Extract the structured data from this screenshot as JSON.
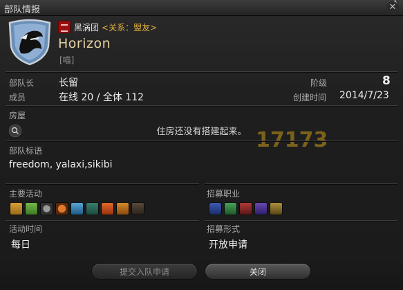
{
  "window": {
    "title": "部队情报",
    "close_symbol": "✕"
  },
  "company": {
    "relation_name": "黑涡团",
    "relation_text": "<关系：盟友>",
    "name": "Horizon",
    "tag": "[喵]"
  },
  "info": {
    "leader_label": "部队长",
    "leader_value": "长留",
    "rank_label": "阶级",
    "rank_value": "8",
    "members_label": "成员",
    "members_value": "在线 20 / 全体 112",
    "created_label": "创建时间",
    "created_value": "2014/7/23"
  },
  "housing": {
    "label": "房屋",
    "message": "住房还没有搭建起来。"
  },
  "slogan": {
    "label": "部队标语",
    "text": "freedom, yalaxi,sikibi"
  },
  "activities": {
    "label": "主要活动",
    "icons": [
      "role-playing-icon",
      "leveling-icon",
      "casual-icon",
      "hardcore-icon",
      "dungeons-icon",
      "guildhests-icon",
      "trials-icon",
      "raids-icon",
      "pvp-icon"
    ]
  },
  "recruit_roles": {
    "label": "招募职业",
    "icons": [
      "tank-icon",
      "healer-icon",
      "melee-dps-icon",
      "ranged-dps-icon",
      "crafter-gatherer-icon"
    ]
  },
  "active_time": {
    "label": "活动时间",
    "value": "每日"
  },
  "recruitment": {
    "label": "招募形式",
    "value": "开放申请"
  },
  "buttons": {
    "apply_label": "提交入队申请",
    "close_label": "关闭"
  },
  "watermark": {
    "text": "17173"
  },
  "colors": {
    "fc_name": "#e6d2a2",
    "relation": "#e0b040",
    "relation_badge": "#9a0f0f"
  }
}
